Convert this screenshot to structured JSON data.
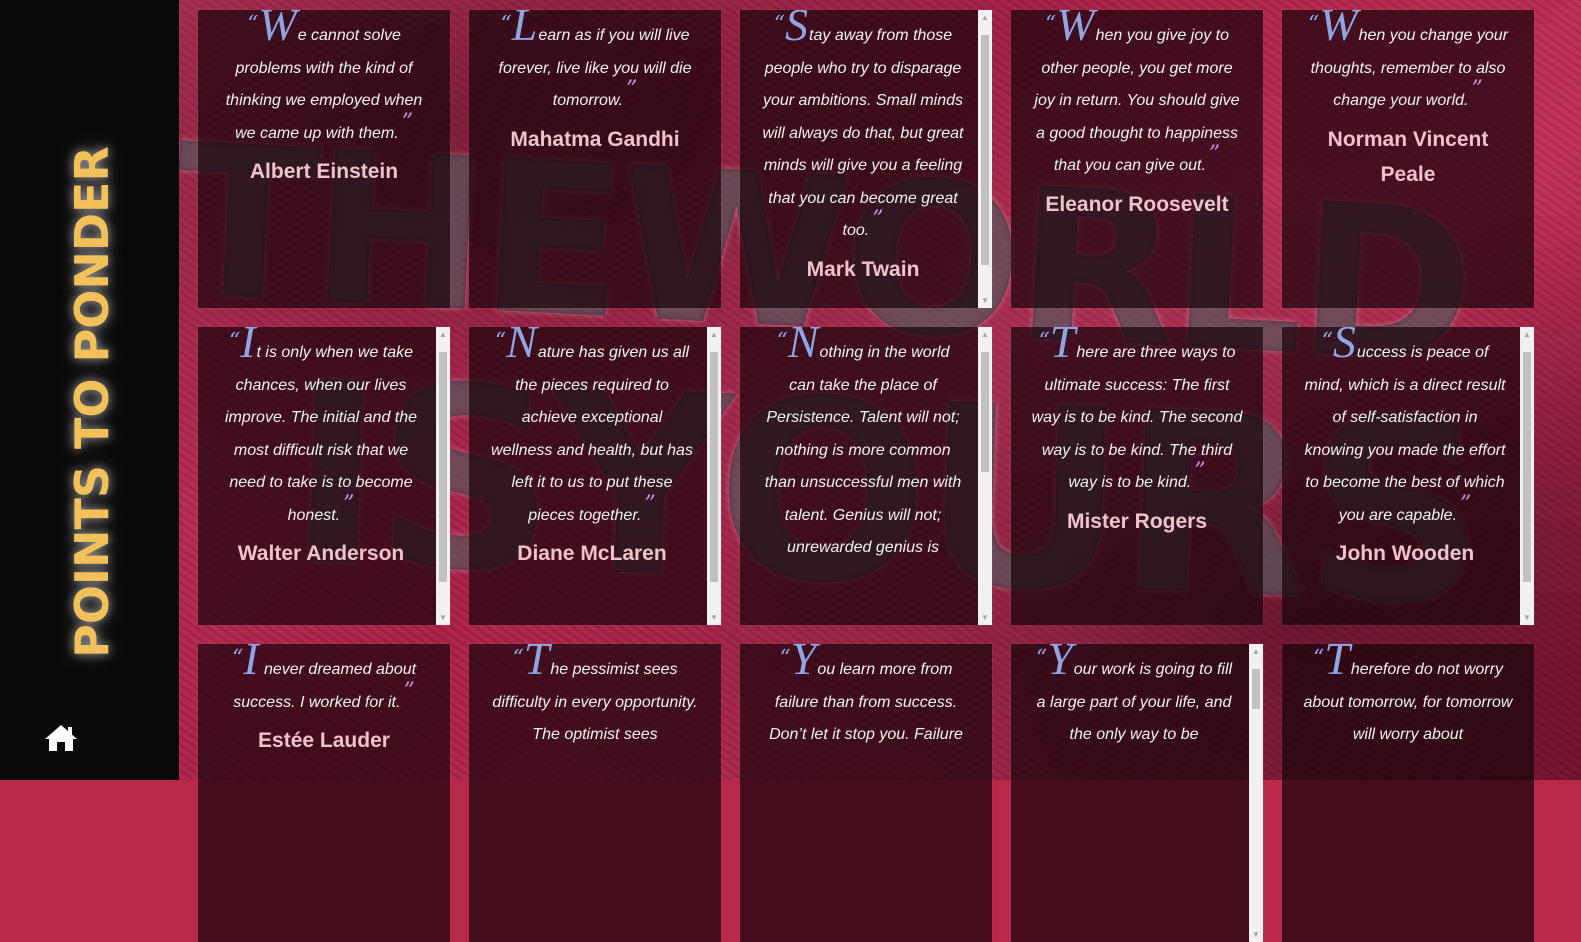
{
  "sidebar": {
    "title": "POINTS TO PONDER",
    "home_icon": "home-icon"
  },
  "quotes": [
    {
      "initial": "W",
      "rest": "e cannot solve problems with the kind of thinking we employed when we came up with them.",
      "author": "Albert Einstein"
    },
    {
      "initial": "L",
      "rest": "earn as if you will live forever, live like you will die tomorrow.",
      "author": "Mahatma Gandhi"
    },
    {
      "initial": "S",
      "rest": "tay away from those people who try to disparage your ambitions. Small minds will always do that, but great minds will give you a feeling that you can become great too.",
      "author": "Mark Twain"
    },
    {
      "initial": "W",
      "rest": "hen you give joy to other people, you get more joy in return. You should give a good thought to happiness that you can give out.",
      "author": "Eleanor Roosevelt"
    },
    {
      "initial": "W",
      "rest": "hen you change your thoughts, remember to also change your world.",
      "author": "Norman Vincent Peale"
    },
    {
      "initial": "I",
      "rest": "t is only when we take chances, when our lives improve. The initial and the most difficult risk that we need to take is to become honest.",
      "author": "Walter Anderson"
    },
    {
      "initial": "N",
      "rest": "ature has given us all the pieces required to achieve exceptional wellness and health, but has left it to us to put these pieces together.",
      "author": "Diane McLaren"
    },
    {
      "initial": "N",
      "rest": "othing in the world can take the place of Persistence. Talent will not; nothing is more common than unsuccessful men with talent. Genius will not; unrewarded genius is",
      "author": ""
    },
    {
      "initial": "T",
      "rest": "here are three ways to ultimate success: The first way is to be kind. The second way is to be kind. The third way is to be kind.",
      "author": "Mister Rogers"
    },
    {
      "initial": "S",
      "rest": "uccess is peace of mind, which is a direct result of self-satisfaction in knowing you made the effort to become the best of which you are capable.",
      "author": "John Wooden"
    },
    {
      "initial": "I",
      "rest": " never dreamed about success. I worked for it.",
      "author": "Estée Lauder"
    },
    {
      "initial": "T",
      "rest": "he pessimist sees difficulty in every opportunity. The optimist sees",
      "author": ""
    },
    {
      "initial": "Y",
      "rest": "ou learn more from failure than from success. Don’t let it stop you. Failure",
      "author": ""
    },
    {
      "initial": "Y",
      "rest": "our work is going to fill a large part of your life, and the only way to be",
      "author": ""
    },
    {
      "initial": "T",
      "rest": "herefore do not worry about tomorrow, for tomorrow will worry about",
      "author": ""
    }
  ],
  "colors": {
    "sidebar_bg": "#090909",
    "title": "#f2c15a",
    "quote_mark_open": "#8ea4e6",
    "quote_mark_close": "#c693e0",
    "author": "#f0c2cb",
    "background": "#b8284a"
  }
}
